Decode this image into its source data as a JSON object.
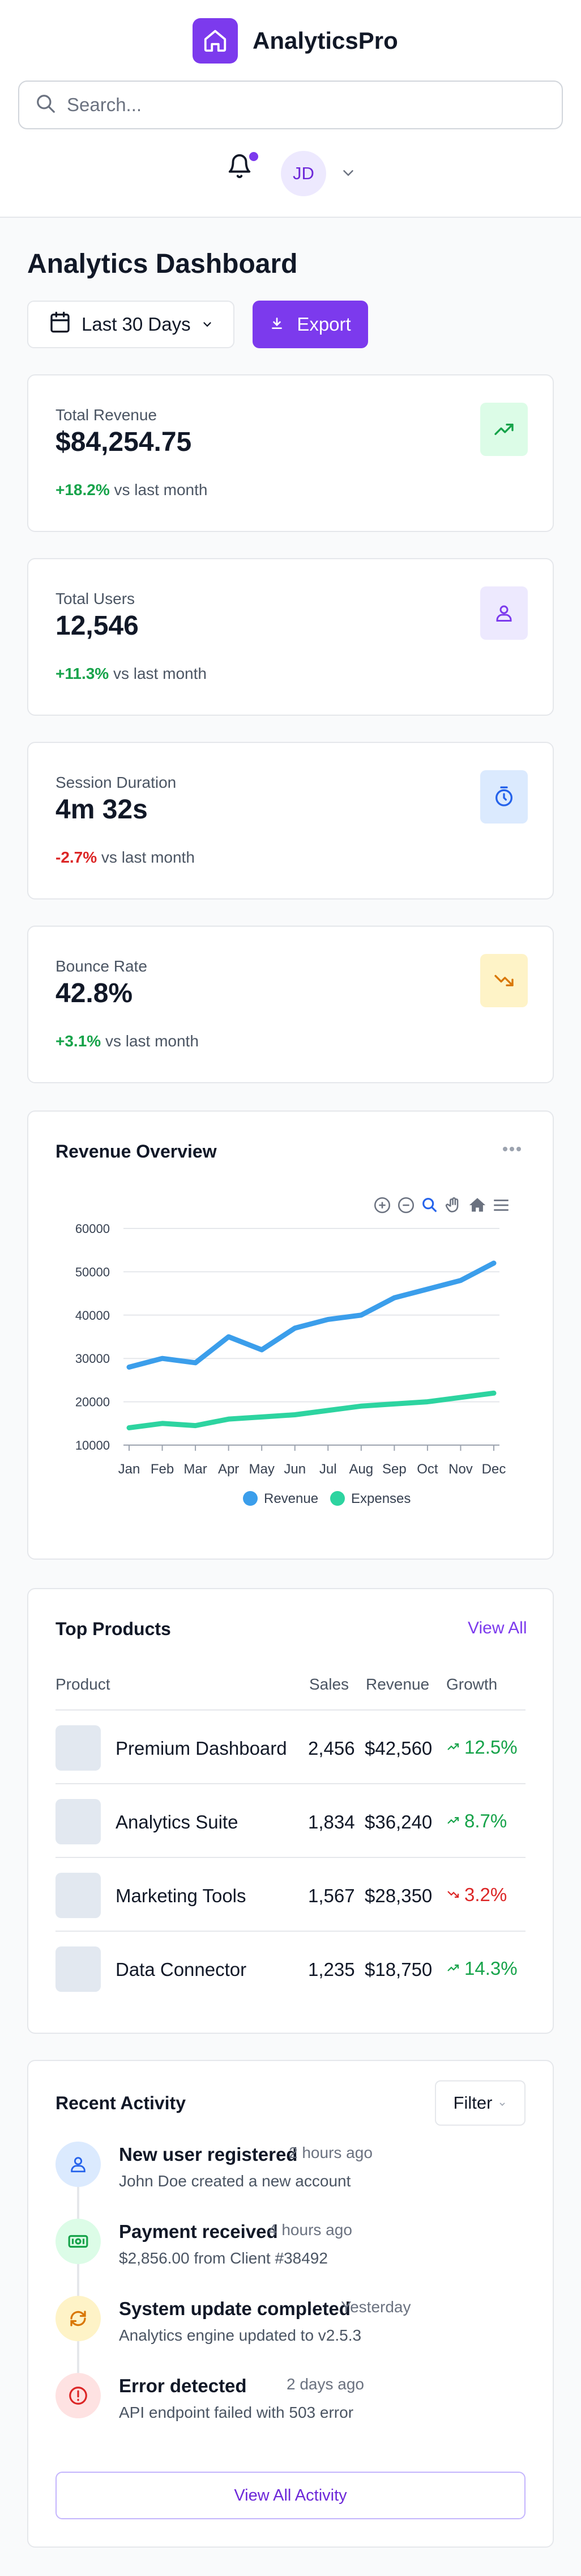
{
  "header": {
    "app_name": "AnalyticsPro",
    "search_placeholder": "Search...",
    "user_initials": "JD"
  },
  "page": {
    "title": "Analytics Dashboard",
    "date_range": "Last 30 Days",
    "export_label": "Export"
  },
  "stats": [
    {
      "label": "Total Revenue",
      "value": "$84,254.75",
      "delta": "+18.2%",
      "suffix": " vs last month",
      "trend": "up",
      "icon": "trending-up-icon"
    },
    {
      "label": "Total Users",
      "value": "12,546",
      "delta": "+11.3%",
      "suffix": " vs last month",
      "trend": "up",
      "icon": "user-icon"
    },
    {
      "label": "Session Duration",
      "value": "4m 32s",
      "delta": "-2.7%",
      "suffix": " vs last month",
      "trend": "down",
      "icon": "timer-icon"
    },
    {
      "label": "Bounce Rate",
      "value": "42.8%",
      "delta": "+3.1%",
      "suffix": " vs last month",
      "trend": "up",
      "icon": "trending-down-icon"
    }
  ],
  "revenue_chart": {
    "title": "Revenue Overview",
    "more_icon": "more-horizontal-icon",
    "toolbar_icons": [
      "zoom-in-icon",
      "zoom-out-icon",
      "zoom-select-icon",
      "pan-icon",
      "reset-zoom-icon",
      "menu-icon"
    ]
  },
  "chart_data": {
    "type": "line",
    "title": "",
    "categories": [
      "Jan",
      "Feb",
      "Mar",
      "Apr",
      "May",
      "Jun",
      "Jul",
      "Aug",
      "Sep",
      "Oct",
      "Nov",
      "Dec"
    ],
    "series": [
      {
        "name": "Revenue",
        "color": "#3b9eeb",
        "values": [
          28000,
          30000,
          29000,
          35000,
          32000,
          37000,
          39000,
          40000,
          44000,
          46000,
          48000,
          52000
        ]
      },
      {
        "name": "Expenses",
        "color": "#2dd4a0",
        "values": [
          14000,
          15000,
          14500,
          16000,
          16500,
          17000,
          18000,
          19000,
          19500,
          20000,
          21000,
          22000
        ]
      }
    ],
    "ylim": [
      10000,
      60000
    ],
    "yticks": [
      "60000",
      "50000",
      "40000",
      "30000",
      "20000",
      "10000"
    ],
    "grid": true,
    "legend": "bottom"
  },
  "products": {
    "title": "Top Products",
    "view_all": "View All",
    "columns": [
      "Product",
      "Sales",
      "Revenue",
      "Growth"
    ],
    "rows": [
      {
        "name": "Premium Dashboard",
        "sales": "2,456",
        "revenue": "$42,560",
        "growth": "12.5%",
        "trend": "up"
      },
      {
        "name": "Analytics Suite",
        "sales": "1,834",
        "revenue": "$36,240",
        "growth": "8.7%",
        "trend": "up"
      },
      {
        "name": "Marketing Tools",
        "sales": "1,567",
        "revenue": "$28,350",
        "growth": "3.2%",
        "trend": "down"
      },
      {
        "name": "Data Connector",
        "sales": "1,235",
        "revenue": "$18,750",
        "growth": "14.3%",
        "trend": "up"
      }
    ]
  },
  "activity": {
    "title": "Recent Activity",
    "filter_label": "Filter",
    "view_all": "View All Activity",
    "items": [
      {
        "title": "New user registered",
        "time": "2 hours ago",
        "desc": "John Doe created a new account",
        "icon": "user-icon"
      },
      {
        "title": "Payment received",
        "time": "4 hours ago",
        "desc": "$2,856.00 from Client #38492",
        "icon": "money-icon"
      },
      {
        "title": "System update completed",
        "time": "Yesterday",
        "desc": "Analytics engine updated to v2.5.3",
        "icon": "refresh-icon"
      },
      {
        "title": "Error detected",
        "time": "2 days ago",
        "desc": "API endpoint failed with 503 error",
        "icon": "alert-icon"
      }
    ]
  }
}
